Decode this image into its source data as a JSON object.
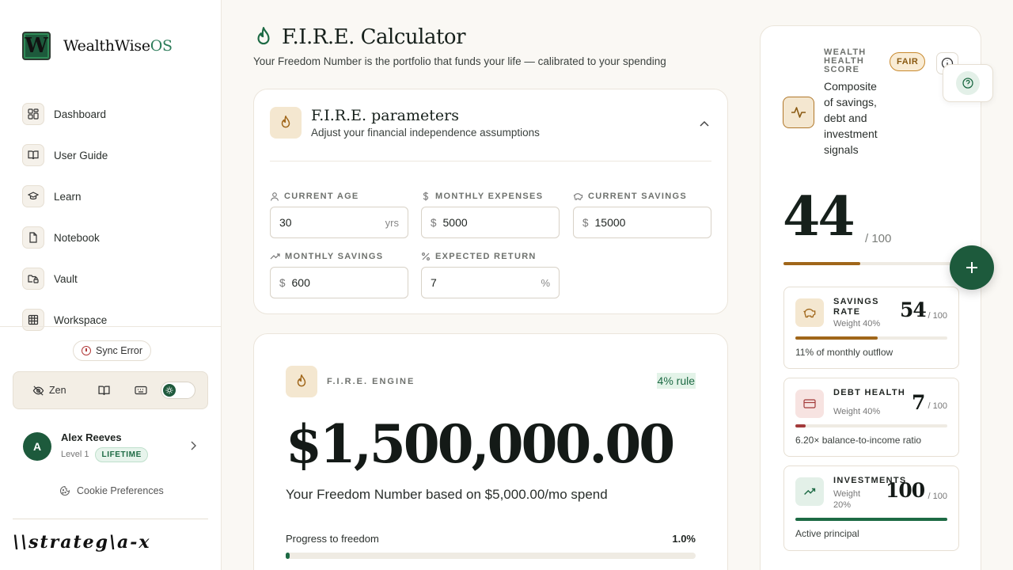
{
  "brand": {
    "logo_letter": "W",
    "name": "WealthWise",
    "suffix": "OS"
  },
  "sidebar": {
    "items": [
      {
        "label": "Dashboard",
        "icon": "grid-icon"
      },
      {
        "label": "User Guide",
        "icon": "book-icon"
      },
      {
        "label": "Learn",
        "icon": "graduation-cap-icon"
      },
      {
        "label": "Notebook",
        "icon": "file-icon"
      },
      {
        "label": "Vault",
        "icon": "folder-lock-icon"
      },
      {
        "label": "Workspace",
        "icon": "table-icon"
      }
    ],
    "sync_status": "Sync Error",
    "zen_label": "Zen",
    "user": {
      "initial": "A",
      "name": "Alex Reeves",
      "level": "Level 1",
      "plan": "LIFETIME"
    },
    "cookie_label": "Cookie Preferences",
    "footer_logo": "\\\\strateg\\a-x"
  },
  "main": {
    "title": "F.I.R.E. Calculator",
    "subtitle": "Your Freedom Number is the portfolio that funds your life — calibrated to your spending",
    "params": {
      "title": "F.I.R.E. parameters",
      "subtitle": "Adjust your financial independence assumptions",
      "fields": {
        "age": {
          "label": "CURRENT AGE",
          "value": "30",
          "suffix": "yrs"
        },
        "expenses": {
          "label": "MONTHLY EXPENSES",
          "prefix": "$",
          "value": "5000"
        },
        "savings": {
          "label": "CURRENT SAVINGS",
          "prefix": "$",
          "value": "15000"
        },
        "monthly_savings": {
          "label": "MONTHLY SAVINGS",
          "prefix": "$",
          "value": "600"
        },
        "return": {
          "label": "EXPECTED RETURN",
          "value": "7",
          "suffix": "%"
        }
      }
    },
    "engine": {
      "label": "F.I.R.E. ENGINE",
      "rule": "4% rule",
      "freedom_number": "$1,500,000.00",
      "freedom_text": "Your Freedom Number based on $5,000.00/mo spend",
      "progress_label": "Progress to freedom",
      "progress_value": "1.0%",
      "progress_fraction": 0.01
    }
  },
  "score": {
    "title": "WEALTH HEALTH SCORE",
    "description": "Composite of savings, debt and investment signals",
    "rating": "FAIR",
    "value": "44",
    "out_of": "/ 100",
    "fraction": 0.44,
    "cards": [
      {
        "title": "SAVINGS RATE",
        "weight": "Weight 40%",
        "score": "54",
        "out_of": "/ 100",
        "fraction": 0.54,
        "color": "#a0661a",
        "note": "11% of monthly outflow"
      },
      {
        "title": "DEBT HEALTH",
        "weight": "Weight 40%",
        "score": "7",
        "out_of": "/ 100",
        "fraction": 0.07,
        "color": "#a33a3a",
        "note": "6.20× balance-to-income ratio"
      },
      {
        "title": "INVESTMENTS",
        "weight": "Weight 20%",
        "score": "100",
        "out_of": "/ 100",
        "fraction": 1.0,
        "color": "#1d6a44",
        "note": "Active principal"
      }
    ]
  },
  "colors": {
    "accent": "#1d5a3c",
    "amber": "#a0661a",
    "danger": "#a33a3a",
    "background": "#faf8f4"
  }
}
